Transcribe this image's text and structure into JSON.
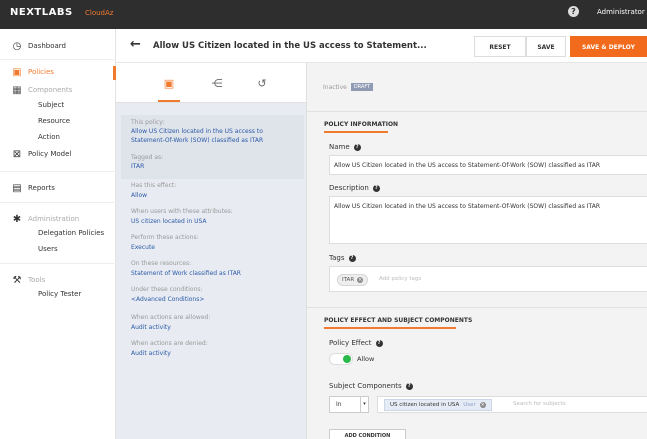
{
  "topbar": {
    "logo": "NEXTLABS",
    "product": "CloudAz",
    "help_icon": "?",
    "user": "Administrator"
  },
  "sidebar": {
    "dashboard": "Dashboard",
    "policies": "Policies",
    "components": "Components",
    "subject": "Subject",
    "resource": "Resource",
    "action": "Action",
    "policy_model": "Policy Model",
    "reports": "Reports",
    "administration": "Administration",
    "delegation_policies": "Delegation Policies",
    "users": "Users",
    "tools": "Tools",
    "policy_tester": "Policy Tester"
  },
  "header": {
    "back_icon": "←",
    "title": "Allow US Citizen located in the US access to Statement...",
    "reset": "RESET",
    "save": "SAVE",
    "save_deploy": "SAVE & DEPLOY"
  },
  "summary": {
    "this_policy_label": "This policy:",
    "this_policy_value": "Allow US Citizen located in the US access to Statement-Of-Work (SOW) classified as ITAR",
    "tagged_label": "Tagged as:",
    "tagged_value": "ITAR",
    "effect_label": "Has this effect:",
    "effect_value": "Allow",
    "users_label": "When users with these attributes:",
    "users_value": "US citizen located in USA",
    "actions_label": "Perform these actions:",
    "actions_value": "Execute",
    "resources_label": "On these resources:",
    "resources_value": "Statement of Work classified as ITAR",
    "conditions_label": "Under these conditions:",
    "conditions_value": "<Advanced Conditions>",
    "allowed_label": "When actions are allowed:",
    "allowed_value": "Audit activity",
    "denied_label": "When actions are denied:",
    "denied_value": "Audit activity"
  },
  "form": {
    "status": "Inactive",
    "draft": "DRAFT",
    "policy_info_title": "POLICY INFORMATION",
    "name_label": "Name",
    "name_value": "Allow US Citizen located in the US access to Statement-Of-Work (SOW) classified as ITAR",
    "description_label": "Description",
    "description_value": "Allow US Citizen located in the US access to Statement-Of-Work (SOW) classified as ITAR",
    "tags_label": "Tags",
    "tag_chip": "ITAR",
    "add_tags_placeholder": "Add policy tags",
    "effect_section_title": "POLICY EFFECT AND SUBJECT COMPONENTS",
    "policy_effect_label": "Policy Effect",
    "allow_label": "Allow",
    "subject_components_label": "Subject Components",
    "operator": "In",
    "component_chip": "US citizen located in USA",
    "component_type": "User",
    "search_subject_placeholder": "Search for subjects",
    "add_condition": "ADD CONDITION"
  },
  "colors": {
    "accent": "#f07a2e",
    "deploy_button": "#f26a1b",
    "toggle_on": "#29b94a",
    "link_blue": "#2b5aa8"
  }
}
